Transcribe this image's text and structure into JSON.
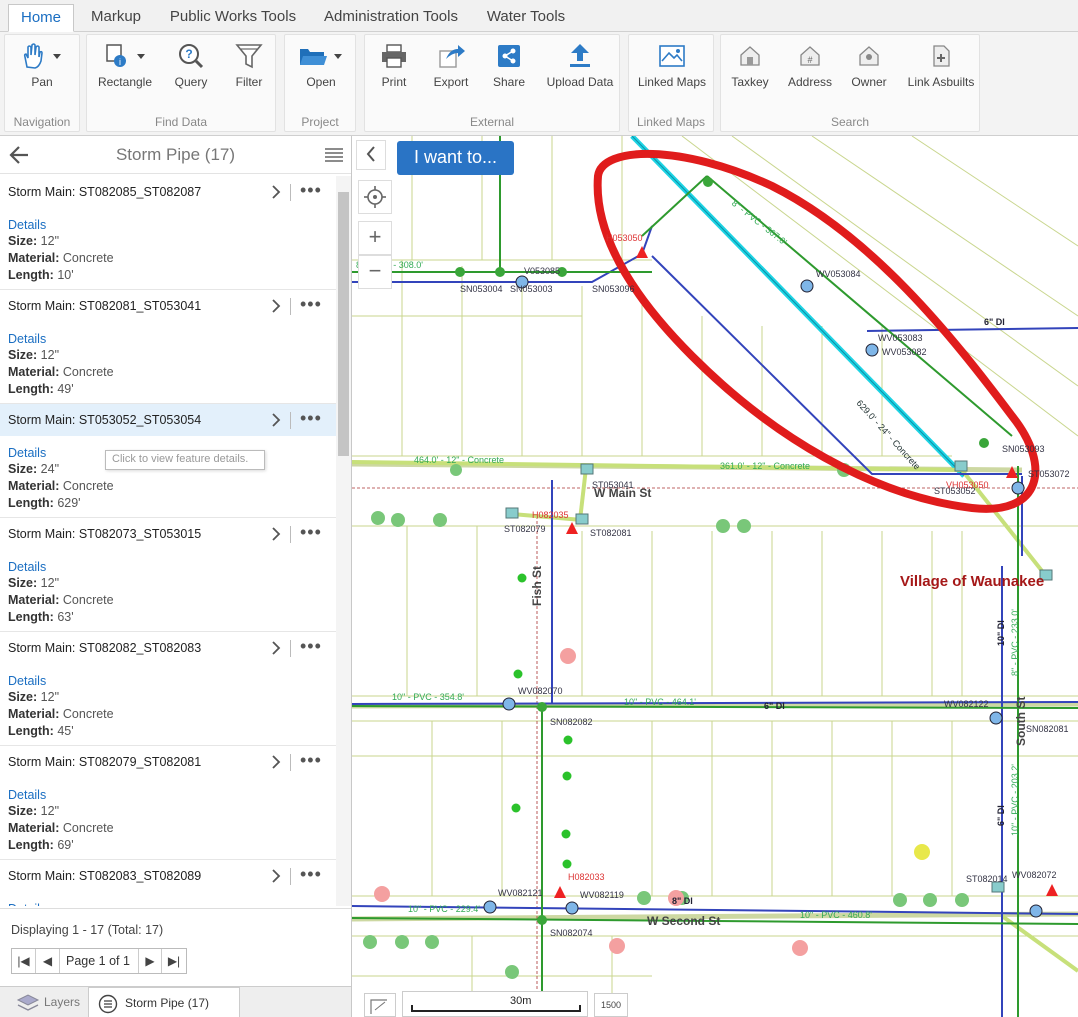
{
  "tabs": [
    "Home",
    "Markup",
    "Public Works Tools",
    "Administration Tools",
    "Water Tools"
  ],
  "ribbon": {
    "groups": {
      "navigation": "Navigation",
      "find_data": "Find Data",
      "project": "Project",
      "external": "External",
      "linked_maps": "Linked Maps",
      "search": "Search"
    },
    "buttons": {
      "pan": "Pan",
      "rectangle": "Rectangle",
      "query": "Query",
      "filter": "Filter",
      "open": "Open",
      "print": "Print",
      "export": "Export",
      "share": "Share",
      "upload": "Upload Data",
      "linked_maps": "Linked Maps",
      "taxkey": "Taxkey",
      "address": "Address",
      "owner": "Owner",
      "link_asbuilts": "Link Asbuilts"
    }
  },
  "panel": {
    "title": "Storm Pipe (17)",
    "details_label": "Details",
    "size_label": "Size:",
    "material_label": "Material:",
    "length_label": "Length:",
    "items": [
      {
        "title": "Storm Main: ST082085_ST082087",
        "size": "12\"",
        "material": "Concrete",
        "length": "10'"
      },
      {
        "title": "Storm Main: ST082081_ST053041",
        "size": "12\"",
        "material": "Concrete",
        "length": "49'"
      },
      {
        "title": "Storm Main: ST053052_ST053054",
        "size": "24\"",
        "material": "Concrete",
        "length": "629'"
      },
      {
        "title": "Storm Main: ST082073_ST053015",
        "size": "12\"",
        "material": "Concrete",
        "length": "63'"
      },
      {
        "title": "Storm Main: ST082082_ST082083",
        "size": "12\"",
        "material": "Concrete",
        "length": "45'"
      },
      {
        "title": "Storm Main: ST082079_ST082081",
        "size": "12\"",
        "material": "Concrete",
        "length": "69'"
      },
      {
        "title": "Storm Main: ST082083_ST082089",
        "size": "",
        "material": "",
        "length": ""
      }
    ],
    "tooltip": "Click to view feature details.",
    "displaying": "Displaying 1 - 17 (Total: 17)",
    "page_label": "Page 1 of 1",
    "bottom_tabs": {
      "layers": "Layers",
      "storm": "Storm Pipe (17)"
    }
  },
  "map": {
    "i_want_to": "I want to...",
    "scale": "30m",
    "scale_box": "1500",
    "labels": {
      "village": "Village of Waunakee",
      "main_st": "W Main St",
      "second_st": "W Second St",
      "fish_st": "Fish St",
      "south_st": "South St",
      "pipe_464": "464.0' - 12\" - Concrete",
      "pipe_361": "361.0' - 12\" - Concrete",
      "pipe_629": "629.0' - 24\" - Concrete",
      "pipe_pvc_308": "8\" - PVC - 308.0'",
      "pipe_pvc_367": "8\" - PVC - 367.0'",
      "pipe_pvc_354": "10\" - PVC - 354.8'",
      "pipe_pvc_464": "10\" - PVC - 464.1'",
      "pipe_pvc_229": "10\" - PVC - 229.4'",
      "pipe_pvc_460": "10\" - PVC - 460.8'",
      "pipe_pvc_233": "8\" - PVC - 233.0'",
      "pipe_pvc_203": "10\" - PVC - 203.2'",
      "di_6": "6\" DI",
      "di_10": "10\" DI",
      "di_8": "8\" DI",
      "sn053004": "SN053004",
      "sn053003": "SN053003",
      "sn053096": "SN053096",
      "v053085": "V053085",
      "wv053084": "WV053084",
      "wv053083": "WV053083",
      "wv053082": "WV053082",
      "h053050": "H053050",
      "st053041": "ST053041",
      "st082079": "ST082079",
      "st082081": "ST082081",
      "h082035": "H082035",
      "wv082070": "WV082070",
      "sn082082": "SN082082",
      "wv082122": "WV082122",
      "sn082081": "SN082081",
      "wv082121": "WV082121",
      "wv082119": "WV082119",
      "h082033": "H082033",
      "sn082074": "SN082074",
      "wv082072": "WV082072",
      "st082014": "ST082014",
      "sn053093": "SN053093",
      "vh053050": "VH053050",
      "st053072": "ST053072",
      "st053052": "ST053052"
    }
  }
}
